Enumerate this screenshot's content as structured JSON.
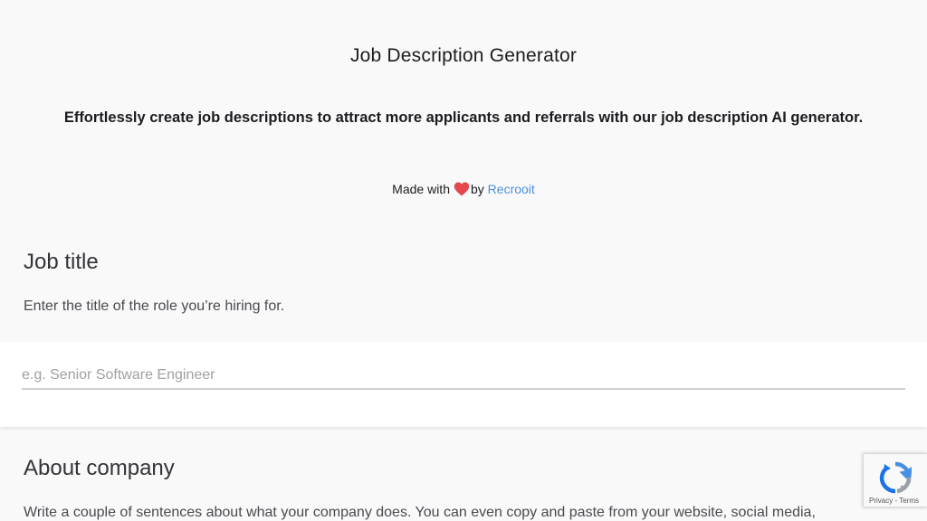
{
  "header": {
    "title": "Job Description Generator",
    "subtitle": "Effortlessly create job descriptions to attract more applicants and referrals with our job description AI generator.",
    "credit_prefix": "Made with",
    "credit_heart_icon": "heart-icon",
    "credit_by": "by",
    "credit_link": "Recrooit",
    "link_color": "#4a8fe0"
  },
  "job_title": {
    "heading": "Job title",
    "help": "Enter the title of the role you’re hiring for.",
    "placeholder": "e.g. Senior Software Engineer",
    "value": ""
  },
  "about_company": {
    "heading": "About company",
    "help": "Write a couple of sentences about what your company does. You can even copy and paste from your website, social media,"
  },
  "recaptcha": {
    "icon": "recaptcha-icon",
    "privacy": "Privacy",
    "separator": " - ",
    "terms": "Terms"
  }
}
